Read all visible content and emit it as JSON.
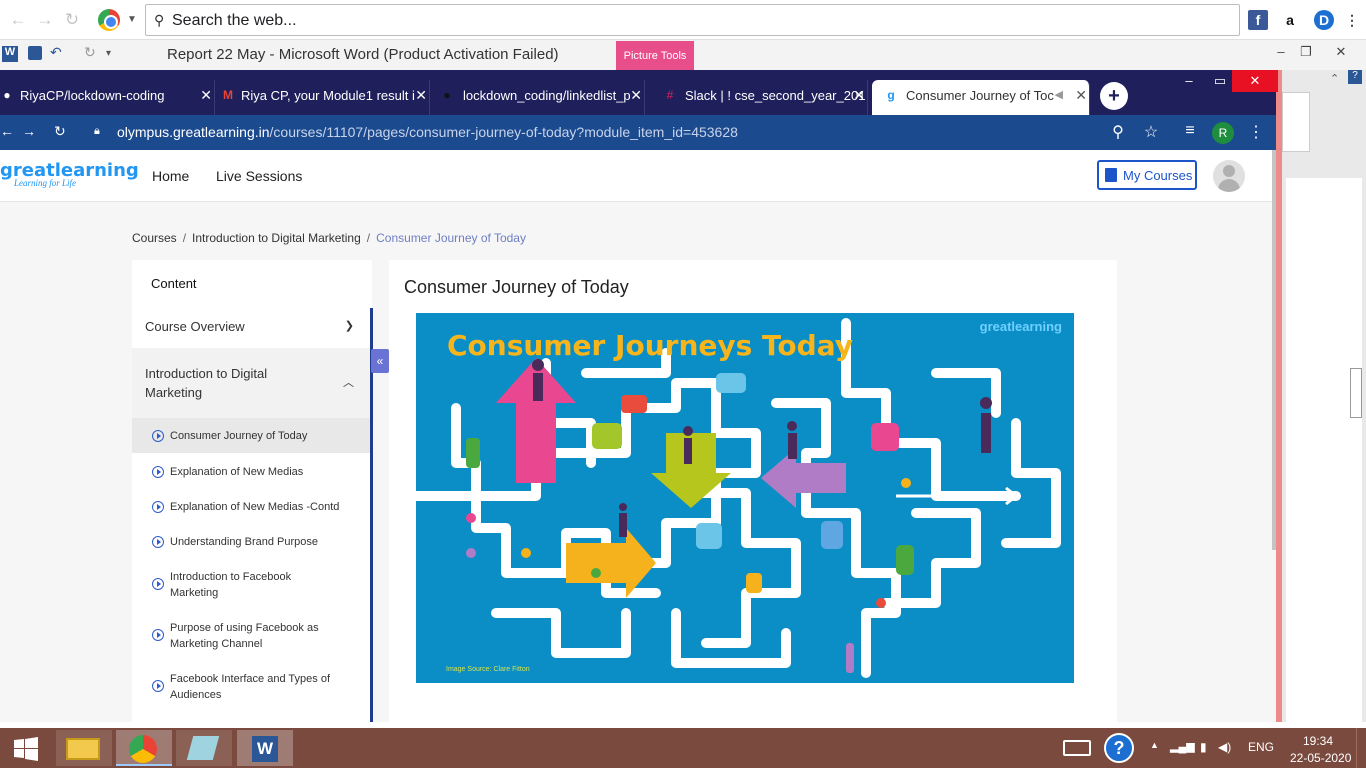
{
  "outer_browser": {
    "search_placeholder": "Search the web..."
  },
  "word_window": {
    "title": "Report 22 May  -  Microsoft Word (Product Activation Failed)",
    "picture_tools": "Picture Tools"
  },
  "tabs": [
    {
      "label": "RiyaCP/lockdown-coding",
      "icon": "github-icon"
    },
    {
      "label": "Riya CP, your Module1 result i",
      "icon": "gmail-icon"
    },
    {
      "label": "lockdown_coding/linkedlist_p",
      "icon": "github-icon"
    },
    {
      "label": "Slack | ! cse_second_year_201",
      "icon": "slack-icon"
    },
    {
      "label": "Consumer Journey of Toc",
      "icon": "greatlearning-icon"
    }
  ],
  "address": {
    "domain": "olympus.greatlearning.in",
    "path": "/courses/11107/pages/consumer-journey-of-today?module_item_id=453628",
    "profile_initial": "R"
  },
  "header": {
    "logo": "greatlearning",
    "logo_tagline": "Learning for Life",
    "nav": [
      "Home",
      "Live Sessions"
    ],
    "my_courses": "My Courses"
  },
  "breadcrumb": [
    "Courses",
    "Introduction to Digital Marketing",
    "Consumer Journey of Today"
  ],
  "sidebar": {
    "title": "Content",
    "sections": [
      {
        "label": "Course Overview",
        "expanded": false
      },
      {
        "label": "Introduction to Digital Marketing",
        "expanded": true
      }
    ],
    "items": [
      "Consumer Journey of Today",
      "Explanation of New Medias",
      "Explanation of New Medias -Contd",
      "Understanding Brand Purpose",
      "Introduction to Facebook Marketing",
      "Purpose of using Facebook as Marketing Channel",
      "Facebook Interface and Types of Audiences"
    ]
  },
  "content": {
    "title": "Consumer Journey of Today",
    "slide_title": "Consumer Journeys Today",
    "slide_brand": "greatlearning",
    "slide_source": "Image Source: Clare Fitton"
  },
  "taskbar": {
    "language": "ENG",
    "time": "19:34",
    "date": "22-05-2020"
  },
  "colors": {
    "tabstrip": "#1f1f5c",
    "urlbar": "#1c4a8f",
    "accent": "#1c55c9",
    "slide_bg": "#0b8ec5",
    "slide_title": "#f7b51b",
    "taskbar": "#7b4a3e"
  }
}
